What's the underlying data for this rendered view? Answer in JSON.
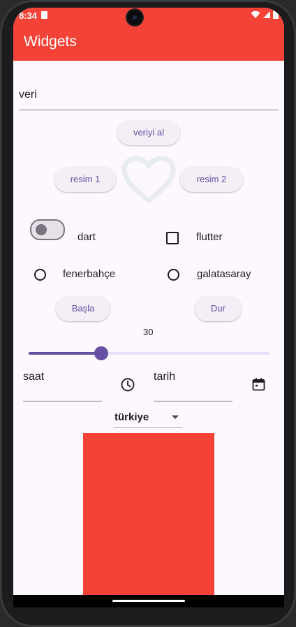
{
  "status_bar": {
    "time": "8:34"
  },
  "app_bar": {
    "title": "Widgets"
  },
  "text_field": {
    "value": "veri"
  },
  "buttons": {
    "get_data": "veriyi al",
    "image1": "resim 1",
    "image2": "resim 2",
    "start": "Başla",
    "stop": "Dur"
  },
  "switch": {
    "label": "dart",
    "on": false
  },
  "checkbox": {
    "label": "flutter",
    "checked": false
  },
  "radios": [
    {
      "label": "fenerbahçe",
      "selected": false
    },
    {
      "label": "galatasaray",
      "selected": false
    }
  ],
  "slider": {
    "value_text": "30",
    "value": 30,
    "min": 0,
    "max": 100
  },
  "time_field": {
    "value": "saat"
  },
  "date_field": {
    "value": "tarih"
  },
  "dropdown": {
    "selected": "türkiye"
  },
  "colors": {
    "primary": "#f44336",
    "accent": "#6750a4",
    "background": "#fdf7fe"
  }
}
